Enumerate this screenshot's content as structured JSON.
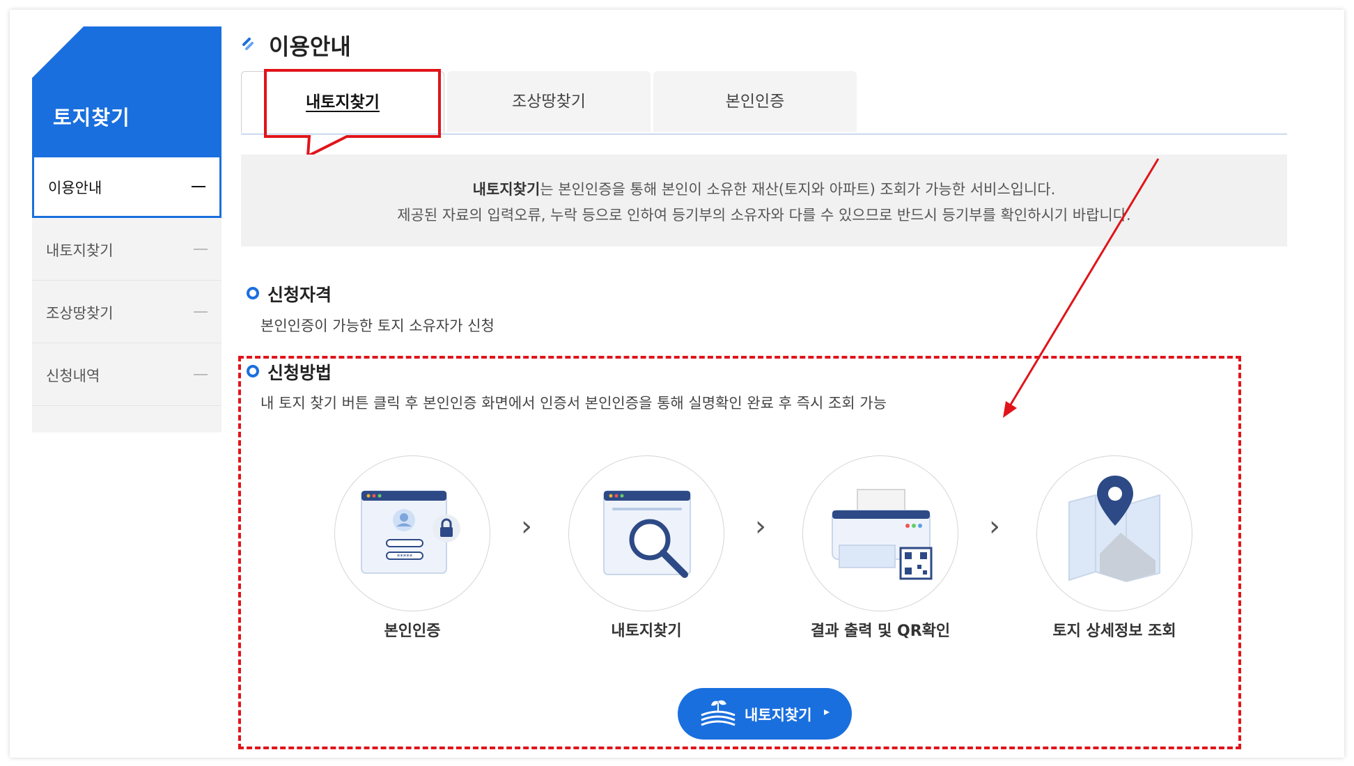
{
  "sidebar": {
    "header": "토지찾기",
    "items": [
      {
        "label": "이용안내"
      },
      {
        "label": "내토지찾기"
      },
      {
        "label": "조상땅찾기"
      },
      {
        "label": "신청내역"
      }
    ]
  },
  "main": {
    "title": "이용안내",
    "tabs": [
      {
        "label": "내토지찾기"
      },
      {
        "label": "조상땅찾기"
      },
      {
        "label": "본인인증"
      }
    ],
    "notice": {
      "bold": "내토지찾기",
      "line1_rest": "는 본인인증을 통해 본인이 소유한 재산(토지와 아파트) 조회가 가능한 서비스입니다.",
      "line2": "제공된 자료의 입력오류, 누락 등으로 인하여 등기부의 소유자와 다를 수 있으므로 반드시 등기부를 확인하시기 바랍니다."
    },
    "qualification": {
      "title": "신청자격",
      "desc": "본인인증이 가능한 토지 소유자가 신청"
    },
    "method": {
      "title": "신청방법",
      "desc": "내 토지 찾기 버튼 클릭 후 본인인증 화면에서 인증서 본인인증을 통해 실명확인 완료 후 즉시 조회 가능"
    },
    "steps": [
      {
        "label": "본인인증",
        "icon": "login-lock-icon"
      },
      {
        "label": "내토지찾기",
        "icon": "magnifier-window-icon"
      },
      {
        "label": "결과 출력 및 QR확인",
        "icon": "printer-qr-icon"
      },
      {
        "label": "토지 상세정보 조회",
        "icon": "map-pin-icon"
      }
    ],
    "cta": {
      "label": "내토지찾기",
      "arrow": "▸"
    }
  },
  "colors": {
    "brand_blue": "#1a6fde",
    "highlight_red": "#e0141a"
  }
}
